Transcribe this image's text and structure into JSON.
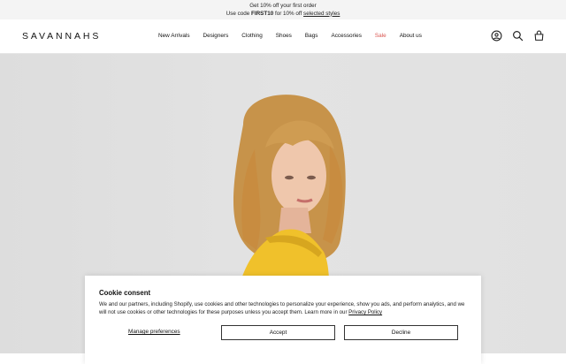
{
  "announcement": {
    "line1": "Get 10% off your first order",
    "line2_prefix": "Use code ",
    "code": "FIRST10",
    "line2_middle": " for 10% off ",
    "link": "selected styles"
  },
  "header": {
    "logo": "SAVANNAHS",
    "nav": [
      "New Arrivals",
      "Designers",
      "Clothing",
      "Shoes",
      "Bags",
      "Accessories",
      "Sale",
      "About us"
    ],
    "icons": [
      "account-icon",
      "search-icon",
      "bag-icon"
    ]
  },
  "cookie": {
    "title": "Cookie consent",
    "text": "We and our partners, including Shopify, use cookies and other technologies to personalize your experience, show you ads, and perform analytics, and we will not use cookies or other technologies for these purposes unless you accept them. Learn more in our ",
    "policy_link": "Privacy Policy",
    "manage": "Manage preferences",
    "accept": "Accept",
    "decline": "Decline"
  },
  "colors": {
    "sale": "#d9534f",
    "announcement_bg": "#f4f4f4"
  }
}
